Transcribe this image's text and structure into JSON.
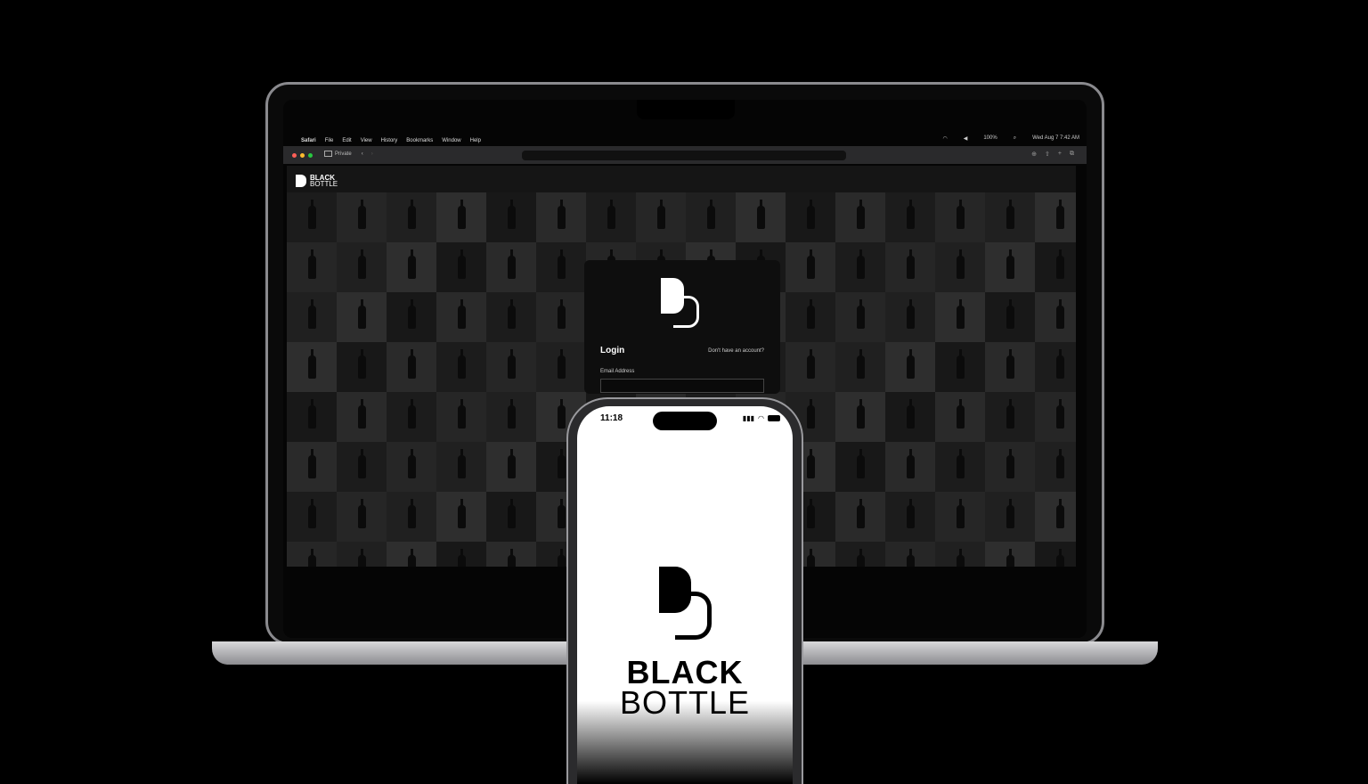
{
  "menubar": {
    "apple": "",
    "items": [
      "Safari",
      "File",
      "Edit",
      "View",
      "History",
      "Bookmarks",
      "Window",
      "Help"
    ],
    "battery": "100%",
    "datetime": "Wed Aug 7  7:42 AM"
  },
  "browser": {
    "tab_label": "Private",
    "colors": {
      "close": "#ff5f57",
      "minimize": "#febc2e",
      "zoom": "#28c840"
    }
  },
  "site": {
    "logo_line1": "BLACK",
    "logo_line2": "BOTTLE",
    "login": {
      "title": "Login",
      "signup_link": "Don't have an account?",
      "email_label": "Email Address",
      "email_value": ""
    }
  },
  "phone": {
    "time": "11:18",
    "brand_line1": "BLACK",
    "brand_line2": "BOTTLE"
  }
}
